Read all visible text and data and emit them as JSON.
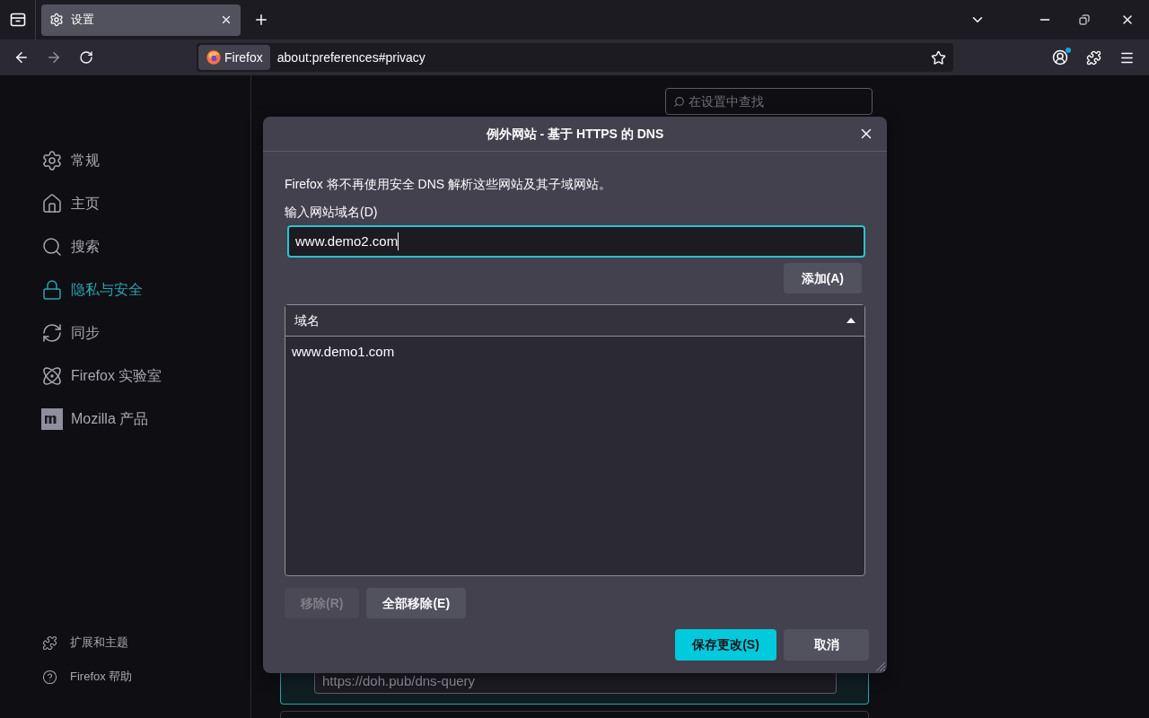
{
  "tabs": [
    {
      "label": "设置",
      "selected": true
    }
  ],
  "address_bar": {
    "identity": "Firefox",
    "url": "about:preferences#privacy"
  },
  "search": {
    "placeholder": "在设置中查找"
  },
  "sidebar": {
    "items": [
      {
        "label": "常规",
        "selected": false
      },
      {
        "label": "主页",
        "selected": false
      },
      {
        "label": "搜索",
        "selected": false
      },
      {
        "label": "隐私与安全",
        "selected": true
      },
      {
        "label": "同步",
        "selected": false
      },
      {
        "label": "Firefox 实验室",
        "selected": false
      },
      {
        "label": "Mozilla 产品",
        "selected": false
      }
    ],
    "footer": [
      {
        "label": "扩展和主题"
      },
      {
        "label": "Firefox 帮助"
      }
    ]
  },
  "dns_provider": {
    "value": "https://doh.pub/dns-query"
  },
  "dialog": {
    "title": "例外网站 - 基于 HTTPS 的 DNS",
    "description": "Firefox 将不再使用安全 DNS 解析这些网站及其子域网站。",
    "field_label": "输入网站域名(D)",
    "field_value": "www.demo2.com",
    "add_button": "添加(A)",
    "list": {
      "column": "域名",
      "sort_ascending": true,
      "rows": [
        {
          "domain": "www.demo1.com",
          "selected": false
        }
      ]
    },
    "buttons": [
      {
        "label": "移除(R)",
        "disabled": true
      },
      {
        "label": "全部移除(E)",
        "disabled": false
      }
    ],
    "footer_buttons": [
      {
        "label": "保存更改(S)",
        "kind": "primary"
      },
      {
        "label": "取消",
        "kind": "secondary"
      }
    ]
  }
}
